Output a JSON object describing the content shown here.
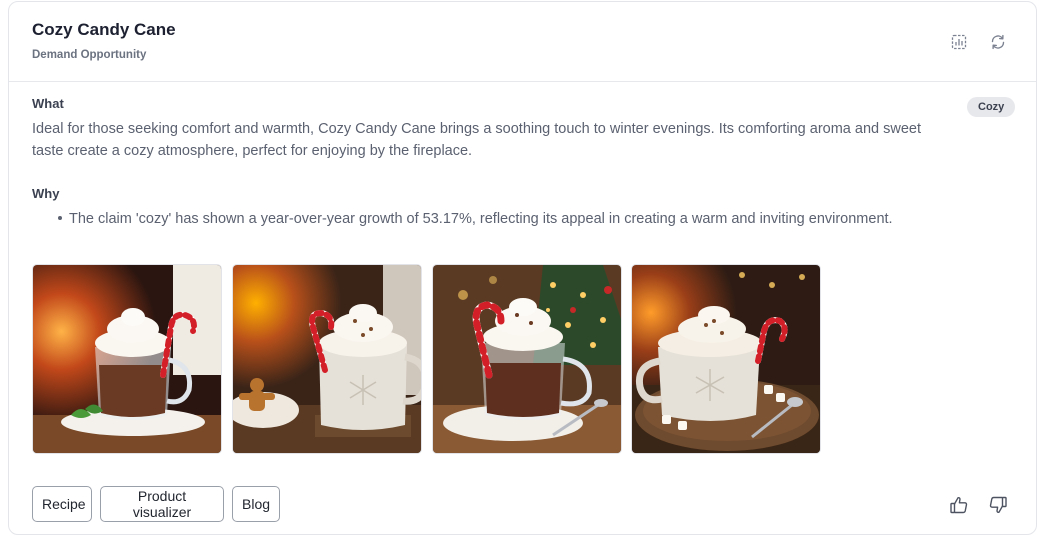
{
  "card": {
    "title": "Cozy Candy Cane",
    "subtitle": "Demand Opportunity",
    "tag": "Cozy"
  },
  "header_icons": [
    "chart-icon",
    "refresh-icon"
  ],
  "what": {
    "label": "What",
    "text": "Ideal for those seeking comfort and warmth, Cozy Candy Cane brings a soothing touch to winter evenings. Its comforting aroma and sweet taste create a cozy atmosphere, perfect for enjoying by the fireplace."
  },
  "why": {
    "label": "Why",
    "bullets": [
      "The claim 'cozy' has shown a year-over-year growth of 53.17%, reflecting its appeal in creating a warm and inviting environment."
    ]
  },
  "images": [
    {
      "name": "hot-chocolate-glass-mug-fireplace"
    },
    {
      "name": "hot-chocolate-snowflake-mug-gingerbread"
    },
    {
      "name": "hot-chocolate-glass-mug-christmas-tree"
    },
    {
      "name": "hot-chocolate-snowflake-mug-marshmallows"
    }
  ],
  "actions": {
    "recipe": "Recipe",
    "product_visualizer": "Product visualizer",
    "blog": "Blog"
  },
  "feedback_icons": [
    "thumbs-up-icon",
    "thumbs-down-icon"
  ],
  "colors": {
    "border": "#e3e5ea",
    "tag_bg": "#e7e8ec",
    "text_muted": "#5b6170",
    "title": "#1c2030"
  }
}
